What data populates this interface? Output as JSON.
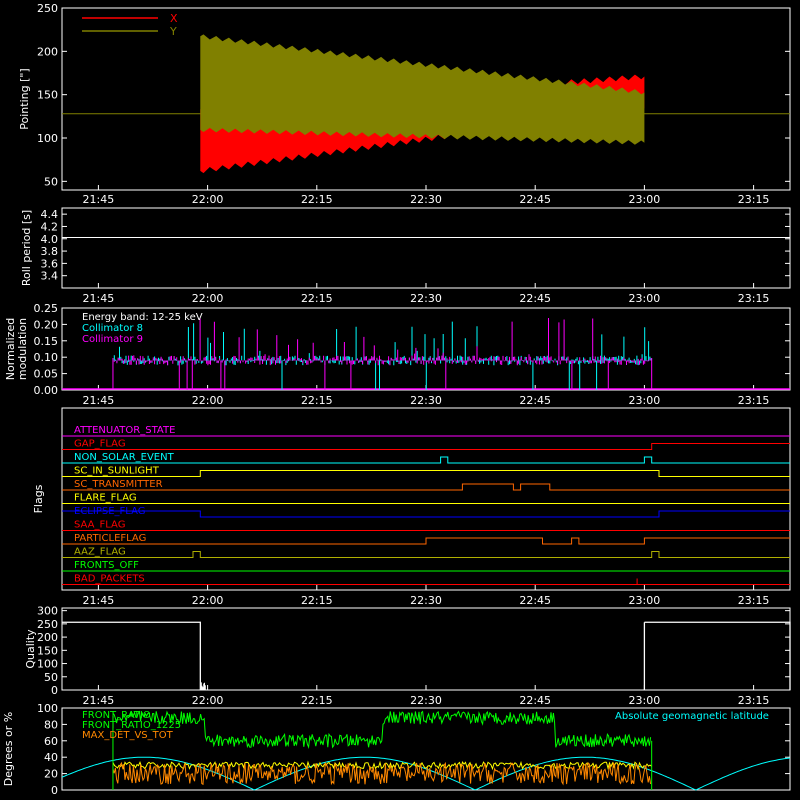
{
  "colors": {
    "background": "#000000",
    "axes": "#ffffff",
    "x_red": "#ff0000",
    "y_olive": "#808000",
    "cyan": "#00ffff",
    "magenta": "#ff00ff",
    "orange": "#ff8800",
    "yellow": "#ffff00",
    "green": "#00ff00",
    "blue": "#0000ff",
    "dark_orange": "#ff6600",
    "olive_flag": "#b0b000"
  },
  "time_ticks": [
    "21:45",
    "22:00",
    "22:15",
    "22:30",
    "22:45",
    "23:00",
    "23:15"
  ],
  "chart_data": [
    {
      "type": "area",
      "panel": "pointing",
      "ylabel": "Pointing [\"]",
      "ylim": [
        40,
        250
      ],
      "yticks": [
        "250",
        "200",
        "150",
        "100",
        "50"
      ],
      "series": [
        {
          "name": "X",
          "color": "red",
          "description_values": {
            "start": "21:59",
            "end": "23:00",
            "initial_range": [
              65,
              130
            ],
            "final_range": [
              135,
              170
            ]
          }
        },
        {
          "name": "Y",
          "color": "olive",
          "description_values": {
            "start": "21:59",
            "end": "23:00",
            "initial_range": [
              110,
              215
            ],
            "final_range": [
              95,
              155
            ]
          }
        }
      ],
      "reference_level": 128
    },
    {
      "type": "line",
      "panel": "roll_period",
      "ylabel": "Roll period [s]",
      "ylim": [
        3.2,
        4.5
      ],
      "yticks": [
        "4.4",
        "4.2",
        "4.0",
        "3.8",
        "3.6",
        "3.4"
      ],
      "series": [
        {
          "name": "",
          "value": 4.02
        }
      ]
    },
    {
      "type": "bar",
      "panel": "modulation",
      "ylabel_line1": "Normalized",
      "ylabel_line2": "modulation",
      "ylim": [
        0,
        0.25
      ],
      "yticks": [
        "0.25",
        "0.20",
        "0.15",
        "0.10",
        "0.05",
        "0.00"
      ],
      "legend": [
        "Energy band: 12-25 keV",
        "Collimator 8",
        "Collimator 9"
      ],
      "series": [
        {
          "name": "Collimator 8",
          "color": "cyan",
          "baseline": 0.09,
          "start": "21:47",
          "end": "23:01"
        },
        {
          "name": "Collimator 9",
          "color": "magenta",
          "baseline": 0.09,
          "start": "21:47",
          "end": "23:01"
        }
      ]
    },
    {
      "type": "line",
      "panel": "flags",
      "ylabel": "Flags",
      "flags": [
        {
          "name": "ATTENUATOR_STATE",
          "color": "magenta"
        },
        {
          "name": "GAP_FLAG",
          "color": "red"
        },
        {
          "name": "NON_SOLAR_EVENT",
          "color": "cyan"
        },
        {
          "name": "SC_IN_SUNLIGHT",
          "color": "yellow"
        },
        {
          "name": "SC_TRANSMITTER",
          "color": "orange"
        },
        {
          "name": "FLARE_FLAG",
          "color": "yellow"
        },
        {
          "name": "ECLIPSE_FLAG",
          "color": "blue"
        },
        {
          "name": "SAA_FLAG",
          "color": "red"
        },
        {
          "name": "PARTICLEFLAG",
          "color": "orange"
        },
        {
          "name": "AAZ_FLAG",
          "color": "olive"
        },
        {
          "name": "FRONTS_OFF",
          "color": "green"
        },
        {
          "name": "BAD_PACKETS",
          "color": "red"
        }
      ]
    },
    {
      "type": "line",
      "panel": "quality",
      "ylabel": "Quality",
      "ylim": [
        0,
        310
      ],
      "yticks": [
        "300",
        "250",
        "200",
        "150",
        "100",
        "50",
        "0"
      ],
      "series": [
        {
          "name": "",
          "segments": [
            {
              "from": "21:40",
              "to": "21:59",
              "value": 256
            },
            {
              "from": "23:00",
              "to": "23:20",
              "value": 256
            }
          ]
        }
      ]
    },
    {
      "type": "line",
      "panel": "geomagnetic",
      "ylabel": "Degrees or %",
      "ylim": [
        0,
        100
      ],
      "yticks": [
        "100",
        "80",
        "60",
        "40",
        "20",
        "0"
      ],
      "series": [
        {
          "name": "FRONT_RATIO",
          "color": "green"
        },
        {
          "name": "FRONT_RATIO_1225",
          "color": "yellow"
        },
        {
          "name": "MAX_DET_VS_TOT",
          "color": "orange"
        },
        {
          "name": "Absolute geomagnetic latitude",
          "color": "cyan"
        }
      ]
    }
  ],
  "pointing_legend": [
    {
      "label": "X",
      "color": "#ff0000"
    },
    {
      "label": "Y",
      "color": "#808000"
    }
  ]
}
